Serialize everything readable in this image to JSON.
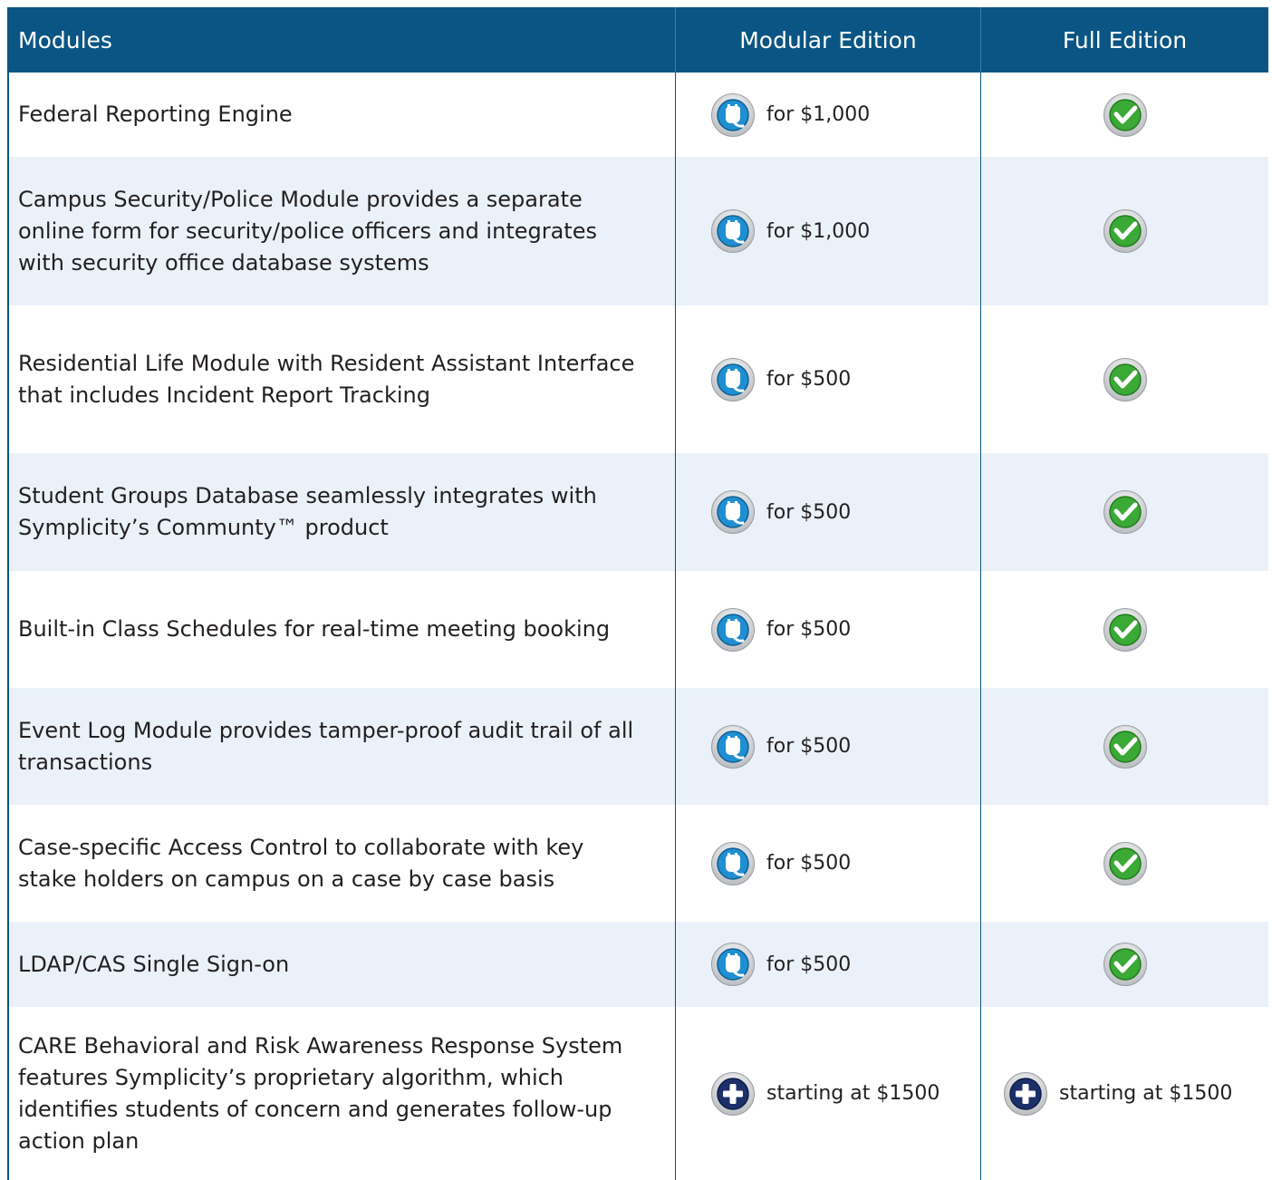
{
  "header": {
    "modules": "Modules",
    "modular_edition": "Modular Edition",
    "full_edition": "Full Edition"
  },
  "colors": {
    "header_bg": "#0a5584",
    "alt_row_bg": "#eaf1f9",
    "plug_blue": "#1f8fd1",
    "check_green": "#3ba935",
    "plus_navy": "#1d2f6b"
  },
  "rows": [
    {
      "module": "Federal Reporting Engine",
      "modular_icon": "plug-icon",
      "modular_price": "for $1,000",
      "full_icon": "check-icon",
      "full_price": ""
    },
    {
      "module": "Campus Security/Police Module provides a separate online form for security/police officers and integrates with security office database systems",
      "modular_icon": "plug-icon",
      "modular_price": "for $1,000",
      "full_icon": "check-icon",
      "full_price": ""
    },
    {
      "module": "Residential Life Module with Resident Assistant Interface that includes Incident Report Tracking",
      "modular_icon": "plug-icon",
      "modular_price": "for $500",
      "full_icon": "check-icon",
      "full_price": ""
    },
    {
      "module": "Student Groups Database seamlessly integrates with Symplicity’s Communty™ product",
      "modular_icon": "plug-icon",
      "modular_price": "for $500",
      "full_icon": "check-icon",
      "full_price": ""
    },
    {
      "module": "Built-in Class Schedules for real-time meeting booking",
      "modular_icon": "plug-icon",
      "modular_price": "for $500",
      "full_icon": "check-icon",
      "full_price": ""
    },
    {
      "module": "Event Log Module provides tamper-proof audit trail of all transactions",
      "modular_icon": "plug-icon",
      "modular_price": "for $500",
      "full_icon": "check-icon",
      "full_price": ""
    },
    {
      "module": "Case-specific Access Control to collaborate with key stake holders on campus on a case by case basis",
      "modular_icon": "plug-icon",
      "modular_price": "for $500",
      "full_icon": "check-icon",
      "full_price": ""
    },
    {
      "module": "LDAP/CAS Single Sign-on",
      "modular_icon": "plug-icon",
      "modular_price": "for $500",
      "full_icon": "check-icon",
      "full_price": ""
    },
    {
      "module": "CARE Behavioral and Risk Awareness Response System features Symplicity’s proprietary algorithm, which identifies students of concern and generates follow-up action plan",
      "modular_icon": "plus-icon",
      "modular_price": "starting at $1500",
      "full_icon": "plus-icon",
      "full_price": "starting at $1500"
    }
  ]
}
